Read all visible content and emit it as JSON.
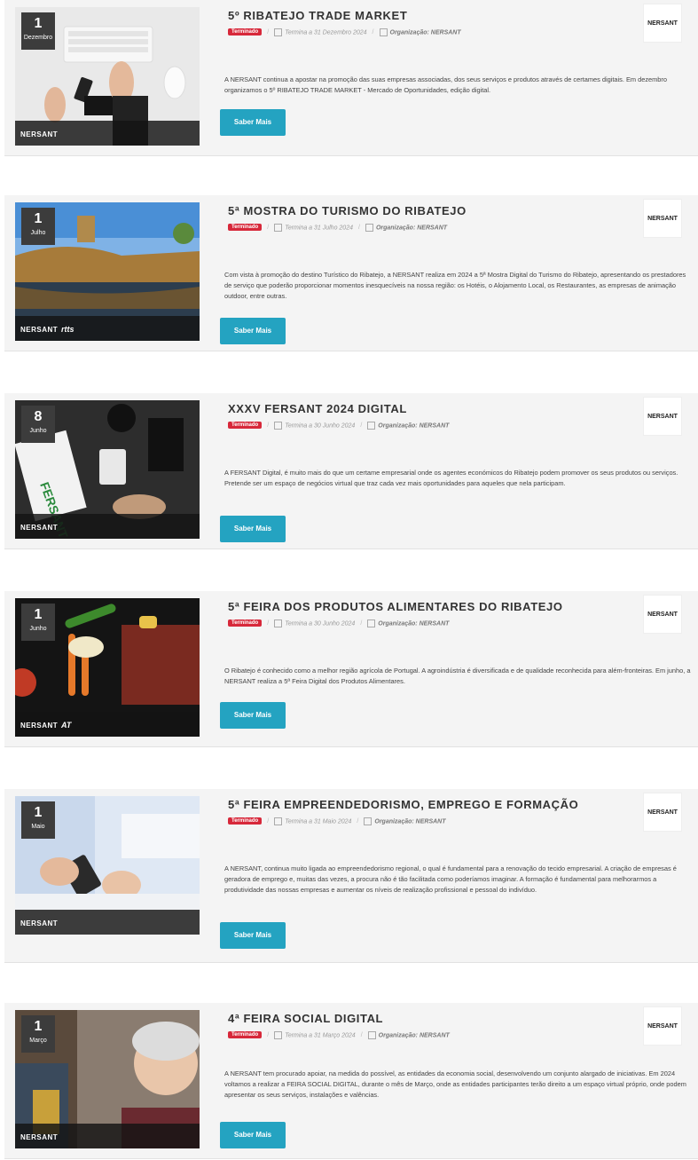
{
  "brand_logo": "NERSANT",
  "colors": {
    "accent_button": "#24a3c1",
    "badge": "#d7283a",
    "card_bg": "#f4f4f4"
  },
  "events": [
    {
      "day": "1",
      "month": "Dezembro",
      "title": "5º RIBATEJO TRADE MARKET",
      "badge": "Terminado",
      "end": "Termina a 31 Dezembro 2024",
      "org": "Organização: NERSANT",
      "description": "A NERSANT continua a apostar na promoção das suas empresas associadas, dos seus serviços e produtos através de certames digitais. Em dezembro organizamos o 5º RIBATEJO TRADE MARKET - Mercado de Oportunidades, edição digital.",
      "button": "Saber Mais",
      "thumb_logo2": ""
    },
    {
      "day": "1",
      "month": "Julho",
      "title": "5ª MOSTRA DO TURISMO DO RIBATEJO",
      "badge": "Terminado",
      "end": "Termina a 31 Julho 2024",
      "org": "Organização: NERSANT",
      "description": "Com vista à promoção do destino Turístico do Ribatejo, a NERSANT realiza em 2024 a 5ª Mostra Digital do Turismo do Ribatejo, apresentando os prestadores de serviço que poderão proporcionar momentos inesquecíveis na nossa região: os Hotéis, o Alojamento Local, os Restaurantes, as empresas de animação outdoor, entre outras.",
      "button": "Saber Mais",
      "thumb_logo2": "rtts"
    },
    {
      "day": "8",
      "month": "Junho",
      "title": "XXXV FERSANT 2024 DIGITAL",
      "badge": "Terminado",
      "end": "Termina a 30 Junho 2024",
      "org": "Organização: NERSANT",
      "description": "A FERSANT Digital, é muito mais do que um certame empresarial onde os agentes económicos do Ribatejo podem promover os seus produtos ou serviços. Pretende ser um espaço de negócios virtual que traz cada vez mais oportunidades para aqueles que nela participam.",
      "button": "Saber Mais",
      "thumb_logo2": ""
    },
    {
      "day": "1",
      "month": "Junho",
      "title": "5ª FEIRA DOS PRODUTOS ALIMENTARES DO RIBATEJO",
      "badge": "Terminado",
      "end": "Termina a 30 Junho 2024",
      "org": "Organização: NERSANT",
      "description": "O Ribatejo é conhecido como a melhor região agrícola de Portugal. A agroindústria é diversificada e de qualidade reconhecida para além-fronteiras. Em junho, a NERSANT realiza a 5ª Feira Digital dos Produtos Alimentares.",
      "button": "Saber Mais",
      "thumb_logo2": "AT"
    },
    {
      "day": "1",
      "month": "Maio",
      "title": "5ª FEIRA EMPREENDEDORISMO, EMPREGO E FORMAÇÃO",
      "badge": "Terminado",
      "end": "Termina a 31 Maio 2024",
      "org": "Organização: NERSANT",
      "description": "A NERSANT, continua muito ligada ao empreendedorismo regional, o qual é fundamental para a renovação do tecido empresarial. A criação de empresas é geradora de emprego e, muitas das vezes, a procura não é tão facilitada como poderíamos imaginar. A formação é fundamental para melhorarmos a produtividade das nossas empresas e aumentar os níveis de realização profissional e pessoal do indivíduo.",
      "button": "Saber Mais",
      "thumb_logo2": ""
    },
    {
      "day": "1",
      "month": "Março",
      "title": "4ª FEIRA SOCIAL DIGITAL",
      "badge": "Terminado",
      "end": "Termina a 31 Março 2024",
      "org": "Organização: NERSANT",
      "description": "A NERSANT tem procurado apoiar, na medida do possível, as entidades da economia social, desenvolvendo um conjunto alargado de iniciativas. Em 2024 voltamos a realizar a FEIRA SOCIAL DIGITAL, durante o mês de Março, onde as entidades participantes terão direito a um espaço virtual próprio, onde podem apresentar os seus serviços, instalações e valências.",
      "button": "Saber Mais",
      "thumb_logo2": ""
    }
  ]
}
